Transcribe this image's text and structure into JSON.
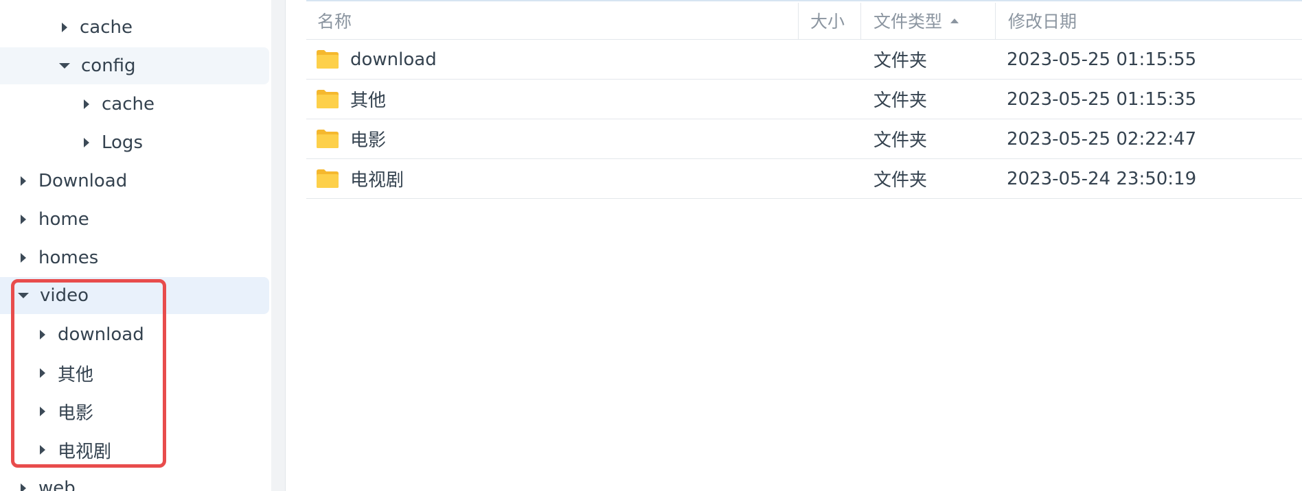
{
  "sidebar": {
    "items": [
      {
        "label": "cache",
        "expanded": false
      },
      {
        "label": "config",
        "expanded": true
      },
      {
        "label": "cache",
        "expanded": false
      },
      {
        "label": "Logs",
        "expanded": false
      },
      {
        "label": "Download",
        "expanded": false
      },
      {
        "label": "home",
        "expanded": false
      },
      {
        "label": "homes",
        "expanded": false
      },
      {
        "label": "video",
        "expanded": true
      },
      {
        "label": "download",
        "expanded": false
      },
      {
        "label": "其他",
        "expanded": false
      },
      {
        "label": "电影",
        "expanded": false
      },
      {
        "label": "电视剧",
        "expanded": false
      },
      {
        "label": "web",
        "expanded": false
      }
    ]
  },
  "table": {
    "columns": {
      "name": "名称",
      "size": "大小",
      "type": "文件类型",
      "modified": "修改日期"
    },
    "rows": [
      {
        "name": "download",
        "size": "",
        "type": "文件夹",
        "modified": "2023-05-25 01:15:55"
      },
      {
        "name": "其他",
        "size": "",
        "type": "文件夹",
        "modified": "2023-05-25 01:15:35"
      },
      {
        "name": "电影",
        "size": "",
        "type": "文件夹",
        "modified": "2023-05-25 02:22:47"
      },
      {
        "name": "电视剧",
        "size": "",
        "type": "文件夹",
        "modified": "2023-05-24 23:50:19"
      }
    ]
  },
  "colors": {
    "folder": "#f9c23c",
    "selected_bg": "#e9f1fb",
    "highlight": "#e84c4c"
  },
  "icons": {
    "tree_collapsed": "caret-right-icon",
    "tree_expanded": "caret-down-icon",
    "folder": "folder-icon",
    "sort": "sort-ascending-icon"
  }
}
